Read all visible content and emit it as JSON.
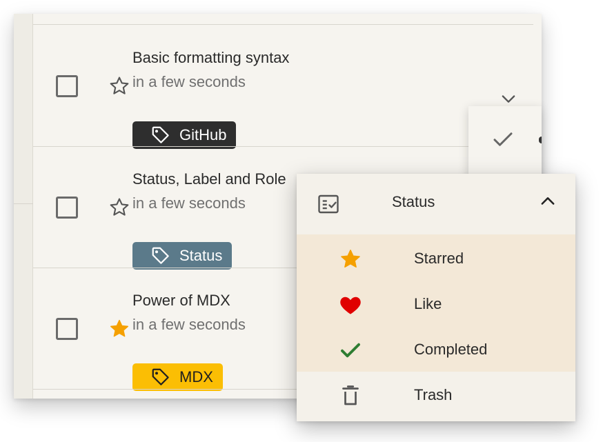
{
  "colors": {
    "star_filled": "#f5a000",
    "heart": "#e00000",
    "check_green": "#2e7d32",
    "chip_github": "#2e2e2e",
    "chip_status": "#5b7a8a",
    "chip_mdx": "#fbbe04",
    "menu_options_bg": "#f3e8d7"
  },
  "items": [
    {
      "title": "Basic formatting syntax",
      "time": "in a few seconds",
      "starred": false,
      "tag": "GitHub",
      "icons": [
        "checkbox-icon",
        "star-outline-icon",
        "tag-icon",
        "chevron-down-icon"
      ]
    },
    {
      "title": "Status, Label and Role",
      "time": "in a few seconds",
      "starred": false,
      "tag": "Status",
      "icons": [
        "checkbox-icon",
        "star-outline-icon",
        "tag-icon"
      ]
    },
    {
      "title": "Power of MDX",
      "time": "in a few seconds",
      "starred": true,
      "tag": "MDX",
      "icons": [
        "checkbox-icon",
        "star-filled-icon",
        "tag-icon"
      ]
    }
  ],
  "mini_panel": {
    "icons": [
      "check-icon"
    ]
  },
  "menu": {
    "header": {
      "label": "Status",
      "icon": "status-list-icon",
      "toggle_icon": "chevron-up-icon"
    },
    "options": [
      {
        "label": "Starred",
        "icon": "star-filled-icon"
      },
      {
        "label": "Like",
        "icon": "heart-icon"
      },
      {
        "label": "Completed",
        "icon": "check-icon"
      }
    ],
    "trash": {
      "label": "Trash",
      "icon": "trash-icon"
    }
  }
}
